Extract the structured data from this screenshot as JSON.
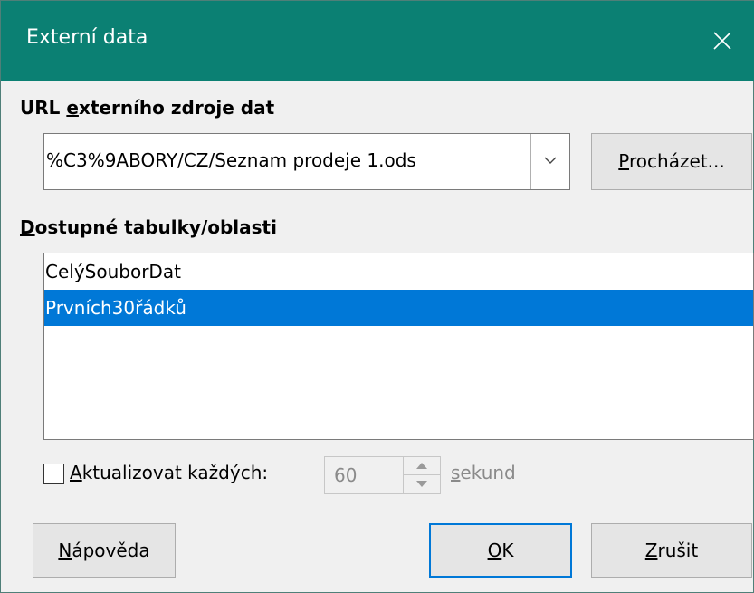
{
  "window": {
    "title": "Externí data",
    "close_icon": "close-icon"
  },
  "url_section": {
    "label_pre": "URL ",
    "label_accel": "e",
    "label_post": "xterního zdroje dat",
    "value": "%C3%9ABORY/CZ/Seznam prodeje 1.ods",
    "dropdown_icon": "chevron-down-icon",
    "browse_accel": "P",
    "browse_rest": "rocházet..."
  },
  "tables_section": {
    "label_accel": "D",
    "label_rest": "ostupné tabulky/oblasti",
    "items": [
      {
        "label": "CelýSouborDat",
        "selected": false
      },
      {
        "label": "Prvních30řádků",
        "selected": true
      }
    ]
  },
  "update": {
    "checked": false,
    "label_accel": "A",
    "label_rest": "ktualizovat každých:",
    "interval": "60",
    "unit_accel": "s",
    "unit_rest": "ekund"
  },
  "buttons": {
    "help_accel": "N",
    "help_rest": "ápověda",
    "ok_accel": "O",
    "ok_rest": "K",
    "cancel_accel": "Z",
    "cancel_rest": "rušit"
  },
  "colors": {
    "titlebar": "#0b8073",
    "selection": "#0078d7",
    "default_button_border": "#0078d7"
  }
}
